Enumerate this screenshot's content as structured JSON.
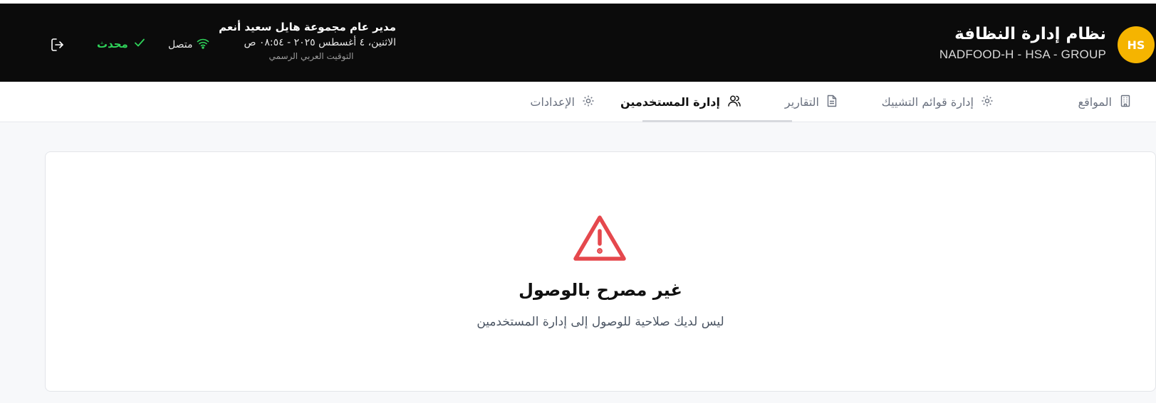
{
  "header": {
    "avatar_initials": "HS",
    "app_title": "نظام إدارة النظافة",
    "app_subtitle": "NADFOOD-H - HSA - GROUP",
    "user_name": "مدير عام مجموعة هايل سعيد أنعم",
    "datetime": "الاثنين، ٤ أغسطس ٢٠٢٥ - ٠٨:٥٤ ص",
    "timezone": "التوقيت العربي الرسمي",
    "connection_label": "متصل",
    "updated_label": "محدث",
    "icons": {
      "connection": "wifi-icon",
      "updated": "check-icon",
      "logout": "logout-icon"
    }
  },
  "tabs": [
    {
      "label": "المواقع",
      "icon": "building-icon",
      "active": false
    },
    {
      "label": "إدارة قوائم التشييك",
      "icon": "gear-icon",
      "active": false
    },
    {
      "label": "التقارير",
      "icon": "document-icon",
      "active": false
    },
    {
      "label": "إدارة المستخدمين",
      "icon": "users-icon",
      "active": true
    },
    {
      "label": "الإعدادات",
      "icon": "gear-icon",
      "active": false
    }
  ],
  "main": {
    "icon": "warning-icon",
    "title": "غير مصرح بالوصول",
    "message": "ليس لديك صلاحية للوصول إلى إدارة المستخدمين"
  },
  "colors": {
    "header_bg": "#0b0b0b",
    "avatar_bg": "#f5b400",
    "connected": "#2fd35a",
    "warning": "#e5484d"
  }
}
